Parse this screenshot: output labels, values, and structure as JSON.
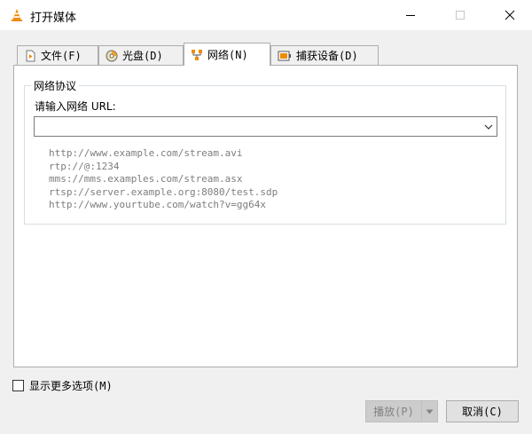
{
  "window": {
    "title": "打开媒体"
  },
  "tabs": [
    {
      "label": "文件(F)",
      "icon": "file-icon"
    },
    {
      "label": "光盘(D)",
      "icon": "disc-icon"
    },
    {
      "label": "网络(N)",
      "icon": "network-icon",
      "active": true
    },
    {
      "label": "捕获设备(D)",
      "icon": "capture-device-icon"
    }
  ],
  "network": {
    "group_title": "网络协议",
    "url_label": "请输入网络 URL:",
    "url_value": "",
    "examples": [
      "http://www.example.com/stream.avi",
      "rtp://@:1234",
      "mms://mms.examples.com/stream.asx",
      "rtsp://server.example.org:8080/test.sdp",
      "http://www.yourtube.com/watch?v=gg64x"
    ]
  },
  "options": {
    "show_more_label": "显示更多选项(M)",
    "show_more_checked": false
  },
  "buttons": {
    "play_label": "播放(P)",
    "cancel_label": "取消(C)"
  },
  "colors": {
    "accent_cone": "#f08a00",
    "hint_text": "#7d7d7d"
  }
}
